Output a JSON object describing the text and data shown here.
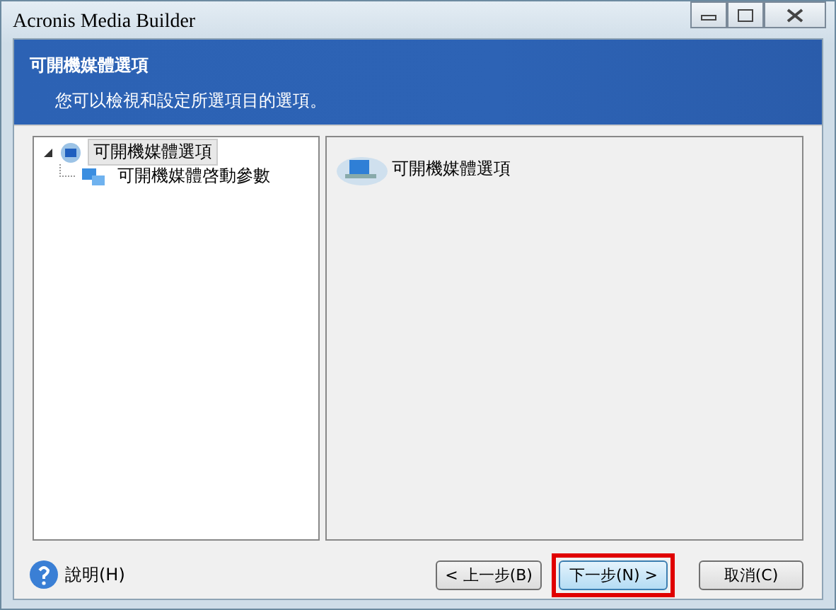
{
  "window": {
    "title": "Acronis Media Builder"
  },
  "header": {
    "title": "可開機媒體選項",
    "subtitle": "您可以檢視和設定所選項目的選項。"
  },
  "tree": [
    {
      "label": "可開機媒體選項",
      "selected": true,
      "expanded": true,
      "children": [
        {
          "label": "可開機媒體啓動參數",
          "selected": false
        }
      ]
    }
  ],
  "detail": {
    "title": "可開機媒體選項"
  },
  "help": {
    "label": "說明(H)"
  },
  "buttons": [
    {
      "label": "< 上一步(B)",
      "highlighted": false,
      "focused": false
    },
    {
      "label": "下一步(N) >",
      "highlighted": true,
      "focused": true
    },
    {
      "label": "取消(C)",
      "highlighted": false,
      "focused": false
    }
  ]
}
